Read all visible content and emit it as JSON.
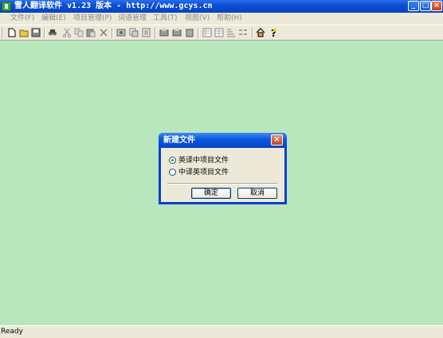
{
  "window": {
    "title": "雪人翻译软件 v1.23 版本 - http://www.gcys.cn",
    "controls": {
      "minimize": "_",
      "maximize": "□",
      "close": "×"
    }
  },
  "menu": {
    "items": [
      {
        "label": "文件(F)"
      },
      {
        "label": "编辑(E)"
      },
      {
        "label": "项目管理(P)"
      },
      {
        "label": "词语管理"
      },
      {
        "label": "工具(T)"
      },
      {
        "label": "视图(V)"
      },
      {
        "label": "帮助(H)"
      }
    ]
  },
  "toolbar": {
    "icons": [
      "new-file-icon",
      "open-folder-icon",
      "save-icon",
      "find-icon",
      "cut-icon",
      "copy-icon",
      "paste-icon",
      "delete-icon",
      "tool-a-icon",
      "tool-b-icon",
      "tool-c-icon",
      "tool-d-icon",
      "tool-e-icon",
      "tool-f-icon",
      "grid-a-icon",
      "grid-b-icon",
      "grid-c-icon",
      "grid-d-icon",
      "home-icon",
      "help-icon"
    ]
  },
  "dialog": {
    "title": "新建文件",
    "close_glyph": "×",
    "options": [
      {
        "label": "英译中项目文件",
        "checked": true
      },
      {
        "label": "中译英项目文件",
        "checked": false
      }
    ],
    "ok_label": "确定",
    "cancel_label": "取消"
  },
  "status": {
    "text": "Ready"
  },
  "colors": {
    "client_background": "#b8e6bd",
    "titlebar": "#0a4fd6",
    "close_button": "#c8401c"
  }
}
